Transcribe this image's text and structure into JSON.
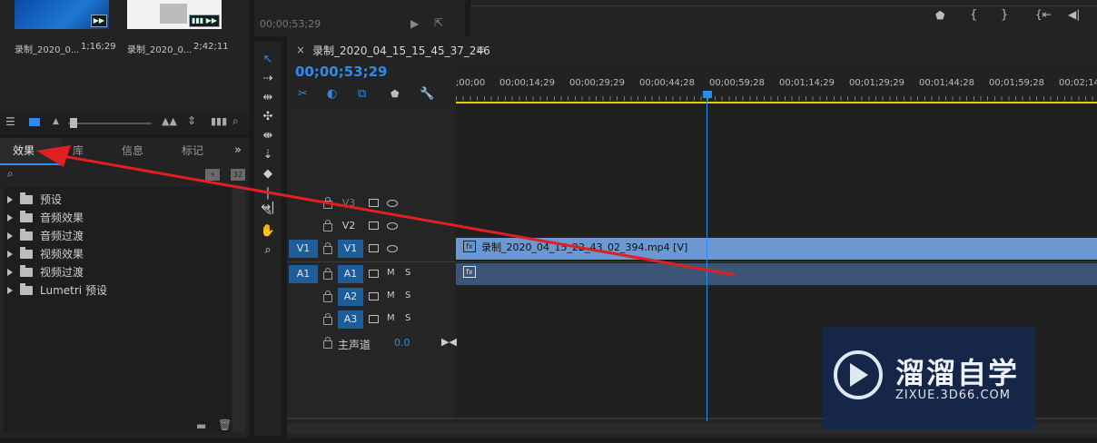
{
  "project": {
    "clips": [
      {
        "name": "录制_2020_0...",
        "duration": "1;16;29"
      },
      {
        "name": "录制_2020_0...",
        "duration": "2;42;11"
      }
    ]
  },
  "source_monitor": {
    "timecode": "00;00;53;29"
  },
  "effects_panel": {
    "tabs": [
      "效果",
      "库",
      "信息",
      "标记"
    ],
    "tree": [
      "预设",
      "音频效果",
      "音频过渡",
      "视频效果",
      "视频过渡",
      "Lumetri 预设"
    ]
  },
  "timeline": {
    "sequence_name": "录制_2020_04_15_15_45_37_246",
    "playhead_timecode": "00;00;53;29",
    "ruler_ticks": [
      ";00;00",
      "00;00;14;29",
      "00;00;29;29",
      "00;00;44;28",
      "00;00;59;28",
      "00;01;14;29",
      "00;01;29;29",
      "00;01;44;28",
      "00;01;59;28",
      "00;02;14"
    ],
    "video_tracks": [
      {
        "src": "",
        "name": "V3"
      },
      {
        "src": "",
        "name": "V2"
      },
      {
        "src": "V1",
        "name": "V1"
      }
    ],
    "audio_tracks": [
      {
        "src": "A1",
        "name": "A1",
        "m": "M",
        "s": "S"
      },
      {
        "src": "",
        "name": "A2",
        "m": "M",
        "s": "S"
      },
      {
        "src": "",
        "name": "A3",
        "m": "M",
        "s": "S"
      }
    ],
    "master": {
      "label": "主声道",
      "value": "0.0"
    },
    "video_clip": {
      "badge": "fx",
      "label": "录制_2020_04_15_22_43_02_394.mp4 [V]"
    },
    "audio_clip": {
      "badge": "fx"
    }
  },
  "watermark": {
    "brand": "溜溜自学",
    "url": "ZIXUE.3D66.COM"
  },
  "colors": {
    "accent": "#2d8ceb",
    "track_active": "#1d5d99",
    "video_clip": "#6b98d0",
    "audio_clip": "#3b5577",
    "arrow": "#e02020"
  }
}
